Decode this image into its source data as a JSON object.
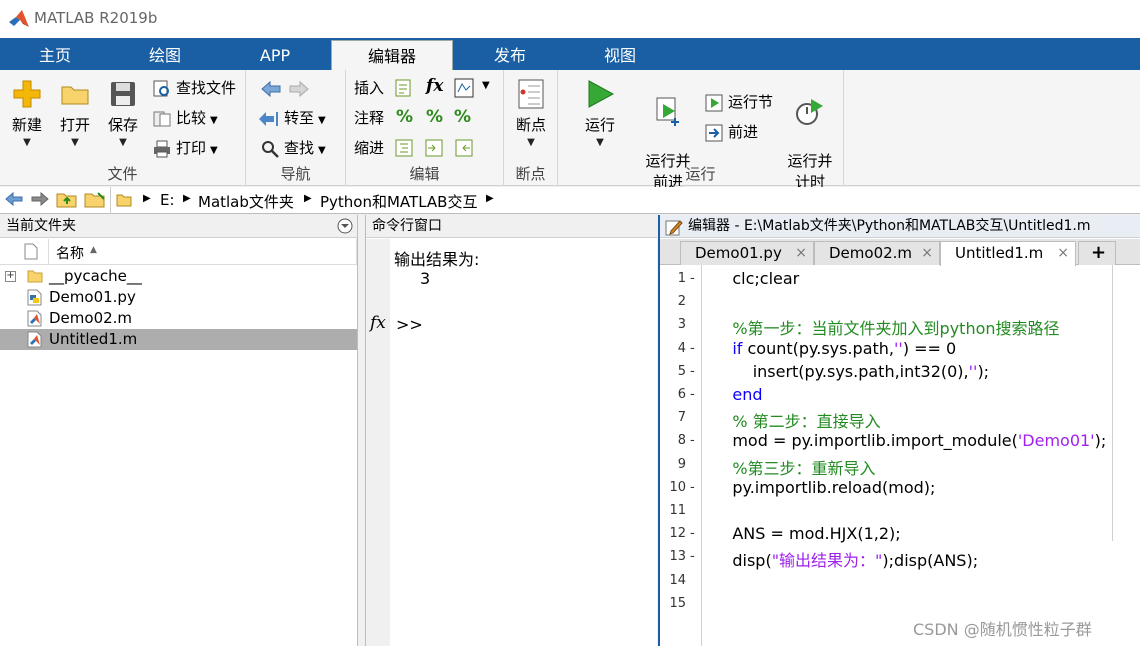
{
  "window": {
    "title": "MATLAB R2019b"
  },
  "tabs": [
    {
      "label": "主页",
      "active": false
    },
    {
      "label": "绘图",
      "active": false
    },
    {
      "label": "APP",
      "active": false
    },
    {
      "label": "编辑器",
      "active": true
    },
    {
      "label": "发布",
      "active": false
    },
    {
      "label": "视图",
      "active": false
    }
  ],
  "ribbon": {
    "file": {
      "label": "文件",
      "new": "新建",
      "open": "打开",
      "save": "保存",
      "find_files": "查找文件",
      "compare": "比较",
      "print": "打印"
    },
    "navigate": {
      "label": "导航",
      "goto": "转至",
      "find": "查找"
    },
    "edit": {
      "label": "编辑",
      "insert": "插入",
      "comment": "注释",
      "indent": "缩进",
      "fx": "fx"
    },
    "breakpoints": {
      "label": "断点",
      "btn": "断点"
    },
    "run": {
      "label": "运行",
      "run": "运行",
      "run_advance": "运行并\n前进",
      "run_section": "运行节",
      "advance": "前进",
      "run_time": "运行并\n计时"
    }
  },
  "address": {
    "drive": "E:",
    "crumbs": [
      "Matlab文件夹",
      "Python和MATLAB交互"
    ]
  },
  "file_panel": {
    "title": "当前文件夹",
    "column": "名称",
    "files": [
      {
        "name": "__pycache__",
        "type": "folder"
      },
      {
        "name": "Demo01.py",
        "type": "py"
      },
      {
        "name": "Demo02.m",
        "type": "m"
      },
      {
        "name": "Untitled1.m",
        "type": "m",
        "selected": true
      }
    ]
  },
  "command_window": {
    "title": "命令行窗口",
    "output_label": "输出结果为:",
    "output_value": "3",
    "fx": "fx",
    "prompt": ">>"
  },
  "editor": {
    "title": "编辑器 - E:\\Matlab文件夹\\Python和MATLAB交互\\Untitled1.m",
    "tabs": [
      "Demo01.py",
      "Demo02.m",
      "Untitled1.m"
    ],
    "active_tab": "Untitled1.m",
    "add_tab": "+",
    "close_glyph": "×",
    "lines": [
      {
        "n": "1",
        "dash": "-",
        "t": "    clc;clear"
      },
      {
        "n": "2",
        "dash": "",
        "t": ""
      },
      {
        "n": "3",
        "dash": "",
        "t": "    %第一步：当前文件夹加入到python搜索路径"
      },
      {
        "n": "4",
        "dash": "-",
        "t": "    if count(py.sys.path,'') == 0"
      },
      {
        "n": "5",
        "dash": "-",
        "t": "        insert(py.sys.path,int32(0),'');"
      },
      {
        "n": "6",
        "dash": "-",
        "t": "    end"
      },
      {
        "n": "7",
        "dash": "",
        "t": "    % 第二步：直接导入"
      },
      {
        "n": "8",
        "dash": "-",
        "t": "    mod = py.importlib.import_module('Demo01');"
      },
      {
        "n": "9",
        "dash": "",
        "t": "    %第三步：重新导入"
      },
      {
        "n": "10",
        "dash": "-",
        "t": "    py.importlib.reload(mod);"
      },
      {
        "n": "11",
        "dash": "",
        "t": ""
      },
      {
        "n": "12",
        "dash": "-",
        "t": "    ANS = mod.HJX(1,2);"
      },
      {
        "n": "13",
        "dash": "-",
        "t": "    disp(\"输出结果为：\");disp(ANS);"
      },
      {
        "n": "14",
        "dash": "",
        "t": ""
      },
      {
        "n": "15",
        "dash": "",
        "t": ""
      }
    ]
  },
  "watermark": "CSDN @随机惯性粒子群",
  "colors": {
    "tab_bar": "#1a5fa4",
    "keyword": "#0e00ff",
    "comment": "#228b22",
    "string": "#a020f0"
  }
}
